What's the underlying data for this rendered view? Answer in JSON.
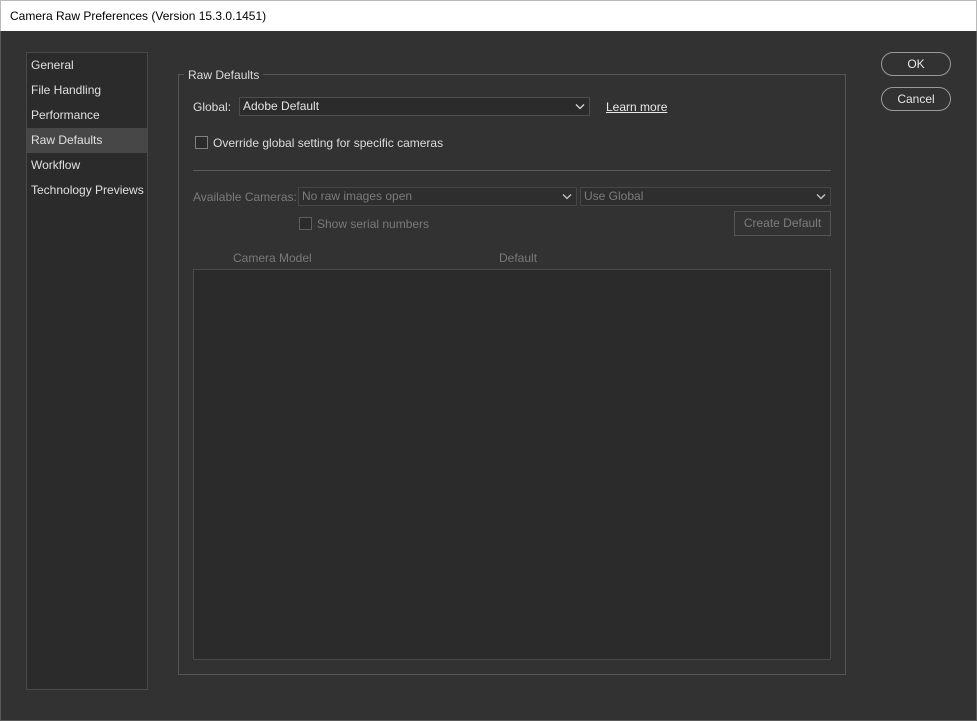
{
  "window": {
    "title": "Camera Raw Preferences  (Version 15.3.0.1451)"
  },
  "sidebar": {
    "items": [
      {
        "label": "General"
      },
      {
        "label": "File Handling"
      },
      {
        "label": "Performance"
      },
      {
        "label": "Raw Defaults",
        "selected": true
      },
      {
        "label": "Workflow"
      },
      {
        "label": "Technology Previews"
      }
    ]
  },
  "raw_defaults": {
    "group_title": "Raw Defaults",
    "global_label": "Global:",
    "global_value": "Adobe Default",
    "learn_more": "Learn more",
    "override_label": "Override global setting for specific cameras",
    "override_checked": false,
    "available_cameras_label": "Available Cameras:",
    "available_cameras_value": "No raw images open",
    "camera_setting_value": "Use Global",
    "show_serial_label": "Show serial numbers",
    "show_serial_checked": false,
    "create_default_label": "Create Default",
    "table": {
      "columns": [
        "Camera Model",
        "Default"
      ],
      "rows": []
    }
  },
  "buttons": {
    "ok": "OK",
    "cancel": "Cancel"
  },
  "colors": {
    "background": "#323232",
    "panel": "#2b2b2b",
    "selected_item": "#474747",
    "text": "#dcdcdc",
    "disabled_text": "#7a7a7a"
  },
  "icons": {
    "dropdown": "chevron-down-icon"
  }
}
